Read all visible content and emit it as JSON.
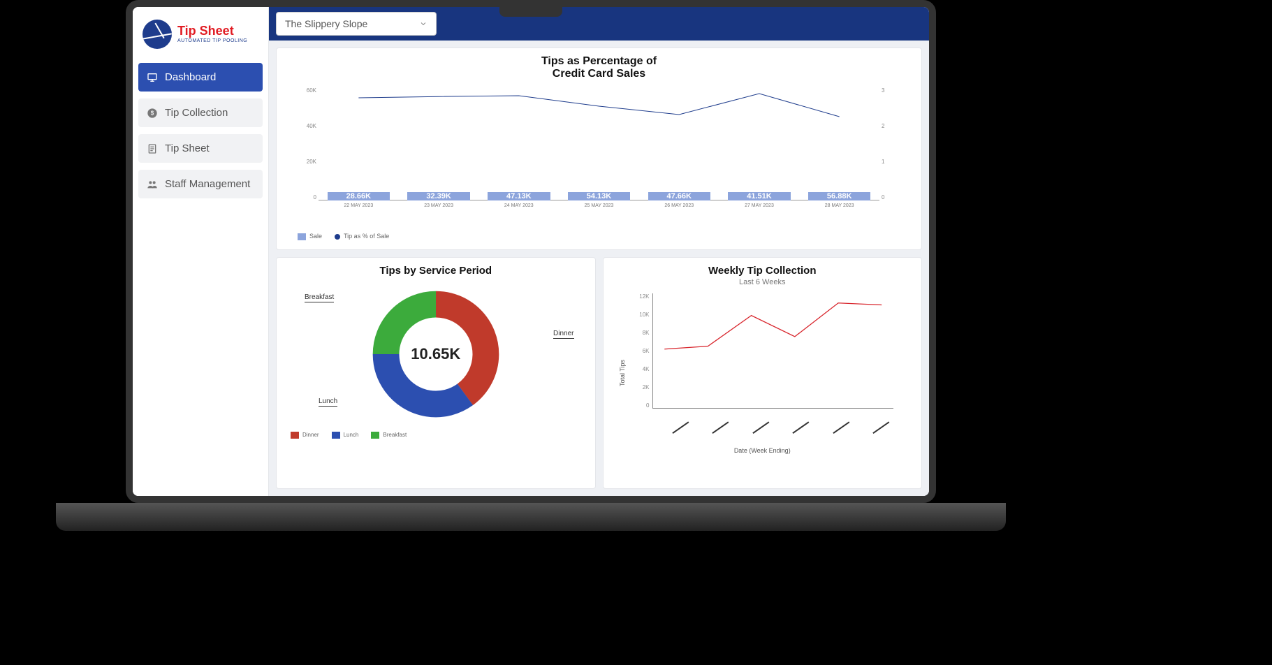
{
  "brand": {
    "title": "Tip Sheet",
    "subtitle": "AUTOMATED TIP POOLING"
  },
  "sidebar": {
    "items": [
      {
        "label": "Dashboard"
      },
      {
        "label": "Tip Collection"
      },
      {
        "label": "Tip Sheet"
      },
      {
        "label": "Staff Management"
      }
    ]
  },
  "topbar": {
    "location": "The Slippery Slope"
  },
  "combo": {
    "title_l1": "Tips as Percentage of",
    "title_l2": "Credit Card Sales",
    "left_ticks": [
      "60K",
      "40K",
      "20K",
      "0"
    ],
    "right_ticks": [
      "3",
      "2",
      "1",
      "0"
    ],
    "legend": {
      "sale": "Sale",
      "tip_pct": "Tip as % of Sale"
    }
  },
  "donut": {
    "title": "Tips by Service Period",
    "center": "10.65K",
    "labels": {
      "breakfast": "Breakfast",
      "lunch": "Lunch",
      "dinner": "Dinner"
    },
    "legend": {
      "dinner": "Dinner",
      "lunch": "Lunch",
      "breakfast": "Breakfast"
    }
  },
  "weekly": {
    "title": "Weekly Tip Collection",
    "subtitle": "Last 6 Weeks",
    "ylabel": "Total Tips",
    "xlabel": "Date (Week Ending)",
    "yticks": [
      "12K",
      "10K",
      "8K",
      "6K",
      "4K",
      "2K",
      "0"
    ]
  },
  "chart_data": [
    {
      "type": "bar+line",
      "title": "Tips as Percentage of Credit Card Sales",
      "categories": [
        "22 MAY 2023",
        "23 MAY 2023",
        "24 MAY 2023",
        "25 MAY 2023",
        "26 MAY 2023",
        "27 MAY 2023",
        "28 MAY 2023"
      ],
      "series": [
        {
          "name": "Sale",
          "axis": "left",
          "type": "bar",
          "values": [
            28.66,
            32.39,
            47.13,
            54.13,
            47.66,
            41.51,
            56.88
          ],
          "labels": [
            "28.66K",
            "32.39K",
            "47.13K",
            "54.13K",
            "47.66K",
            "41.51K",
            "56.88K"
          ],
          "color": "#8ca4dc"
        },
        {
          "name": "Tip as % of Sale",
          "axis": "right",
          "type": "line",
          "values": [
            2.75,
            2.78,
            2.8,
            2.55,
            2.35,
            2.85,
            2.3
          ],
          "color": "#1e3c8c"
        }
      ],
      "y_left": {
        "label": "",
        "ticks": [
          0,
          20,
          40,
          60
        ],
        "max": 60,
        "unit": "K"
      },
      "y_right": {
        "label": "",
        "ticks": [
          0,
          1,
          2,
          3
        ],
        "max": 3
      }
    },
    {
      "type": "donut",
      "title": "Tips by Service Period",
      "center_value": "10.65K",
      "series": [
        {
          "name": "Dinner",
          "value": 4.26,
          "pct": 40,
          "color": "#c03a2b"
        },
        {
          "name": "Lunch",
          "value": 3.73,
          "pct": 35,
          "color": "#2c4fb0"
        },
        {
          "name": "Breakfast",
          "value": 2.66,
          "pct": 25,
          "color": "#3cab3c"
        }
      ],
      "total": 10.65,
      "unit": "K"
    },
    {
      "type": "line",
      "title": "Weekly Tip Collection",
      "subtitle": "Last 6 Weeks",
      "xlabel": "Date (Week Ending)",
      "ylabel": "Total Tips",
      "x_count": 6,
      "values": [
        6.2,
        6.5,
        9.7,
        7.5,
        11.0,
        10.8
      ],
      "ylim": [
        0,
        12
      ],
      "unit": "K",
      "color": "#d8252c"
    }
  ]
}
